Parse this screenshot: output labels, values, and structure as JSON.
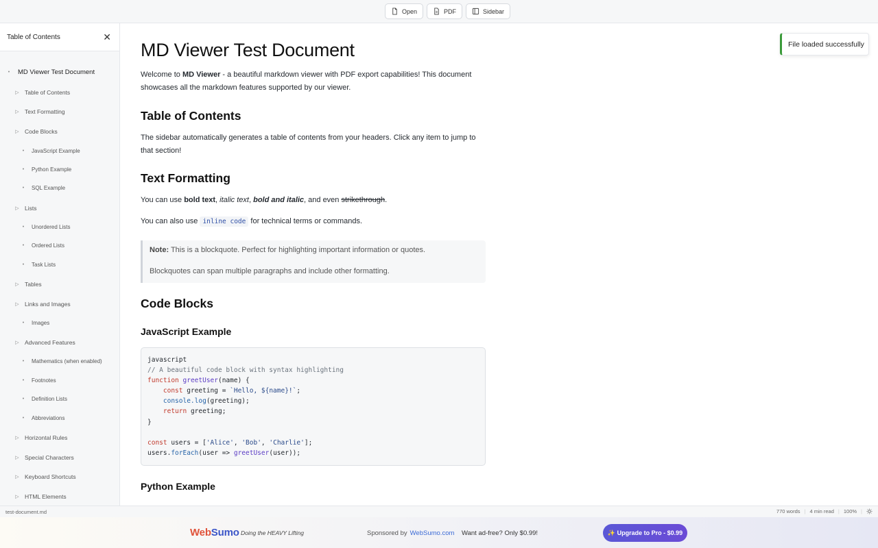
{
  "toolbar": {
    "open_label": "Open",
    "pdf_label": "PDF",
    "sidebar_label": "Sidebar"
  },
  "sidebar": {
    "title": "Table of Contents",
    "items": [
      {
        "label": "MD Viewer Test Document",
        "level": 1
      },
      {
        "label": "Table of Contents",
        "level": 2
      },
      {
        "label": "Text Formatting",
        "level": 2
      },
      {
        "label": "Code Blocks",
        "level": 2
      },
      {
        "label": "JavaScript Example",
        "level": 3
      },
      {
        "label": "Python Example",
        "level": 3
      },
      {
        "label": "SQL Example",
        "level": 3
      },
      {
        "label": "Lists",
        "level": 2
      },
      {
        "label": "Unordered Lists",
        "level": 3
      },
      {
        "label": "Ordered Lists",
        "level": 3
      },
      {
        "label": "Task Lists",
        "level": 3
      },
      {
        "label": "Tables",
        "level": 2
      },
      {
        "label": "Links and Images",
        "level": 2
      },
      {
        "label": "Images",
        "level": 3
      },
      {
        "label": "Advanced Features",
        "level": 2
      },
      {
        "label": "Mathematics (when enabled)",
        "level": 3
      },
      {
        "label": "Footnotes",
        "level": 3
      },
      {
        "label": "Definition Lists",
        "level": 3
      },
      {
        "label": "Abbreviations",
        "level": 3
      },
      {
        "label": "Horizontal Rules",
        "level": 2
      },
      {
        "label": "Special Characters",
        "level": 2
      },
      {
        "label": "Keyboard Shortcuts",
        "level": 2
      },
      {
        "label": "HTML Elements",
        "level": 2
      }
    ]
  },
  "document": {
    "title": "MD Viewer Test Document",
    "intro": {
      "pre": "Welcome to ",
      "bold": "MD Viewer",
      "post": " - a beautiful markdown viewer with PDF export capabilities! This document showcases all the markdown features supported by our viewer."
    },
    "toc_heading": "Table of Contents",
    "toc_text": "The sidebar automatically generates a table of contents from your headers. Click any item to jump to that section!",
    "text_formatting_heading": "Text Formatting",
    "fmt": {
      "t1": "You can use ",
      "bold": "bold text",
      "t2": ", ",
      "italic": "italic text",
      "t3": ", ",
      "bold_italic": "bold and italic",
      "t4": ", and even ",
      "strike": "strikethrough",
      "t5": "."
    },
    "inline": {
      "pre": "You can also use ",
      "code": "inline code",
      "post": " for technical terms or commands."
    },
    "blockquote": {
      "note_label": "Note:",
      "line1": " This is a blockquote. Perfect for highlighting important information or quotes.",
      "line2": "Blockquotes can span multiple paragraphs and include other formatting."
    },
    "code_blocks_heading": "Code Blocks",
    "js_heading": "JavaScript Example",
    "python_heading": "Python Example",
    "code": {
      "lang": "javascript",
      "comment": "// A beautiful code block with syntax highlighting",
      "kw_function": "function",
      "fn_greet": "greetUser",
      "params": "(name) {",
      "kw_const": "const",
      "greeting_decl": " greeting = ",
      "template": "`Hello, ${name}!`",
      "semi": ";",
      "console": "console.",
      "log": "log",
      "log_args": "(greeting);",
      "kw_return": "return",
      "return_val": " greeting;",
      "close": "}",
      "users_decl": " users = [",
      "alice": "'Alice'",
      "comma": ", ",
      "bob": "'Bob'",
      "charlie": "'Charlie'",
      "arr_close": "];",
      "users": "users.",
      "foreach": "forEach",
      "foreach_args": "(user => ",
      "foreach_end": "(user));"
    }
  },
  "toast": {
    "message": "File loaded successfully"
  },
  "status": {
    "filename": "test-document.md",
    "words": "770 words",
    "read_time": "4 min read",
    "zoom": "100%"
  },
  "ad": {
    "logo_a": "Web",
    "logo_b": "Sumo",
    "tagline": "Doing the HEAVY Lifting",
    "sponsored_by": "Sponsored by",
    "sponsor_link": "WebSumo.com",
    "adfree": "Want ad-free? Only $0.99!",
    "upgrade": "✨ Upgrade to Pro - $0.99"
  },
  "colors": {
    "accent": "#5a57d6",
    "toast_border": "#3a9a3a",
    "logo_red": "#e0533b",
    "logo_blue": "#3b55c8"
  }
}
